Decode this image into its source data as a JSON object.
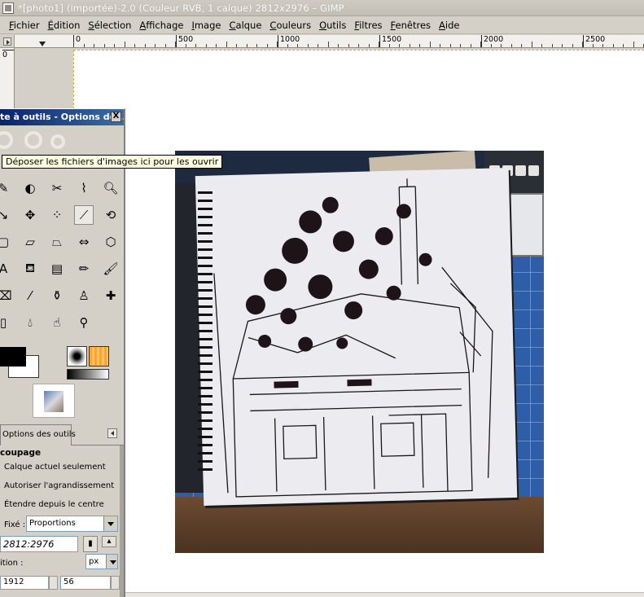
{
  "window": {
    "title": "*[photo1] (importée)-2.0 (Couleur RVB, 1 calque) 2812x2976 – GIMP"
  },
  "menu": [
    "Fichier",
    "Édition",
    "Sélection",
    "Affichage",
    "Image",
    "Calque",
    "Couleurs",
    "Outils",
    "Filtres",
    "Fenêtres",
    "Aide"
  ],
  "ruler": {
    "h_labels": [
      "0",
      "500",
      "1000",
      "1500",
      "2000",
      "2500"
    ],
    "v_labels": [
      "0"
    ]
  },
  "tooltip": "Déposer les fichiers d'images ici pour les ouvrir",
  "toolbox": {
    "title": "te à outils - Options de...",
    "close_label": "X",
    "tab_label": "Options des outils",
    "tool_options": {
      "section": "coupage",
      "opt_current_layer": "Calque actuel seulement",
      "opt_allow_growing": "Autoriser l'agrandissement",
      "opt_expand_center": "Étendre depuis le centre",
      "fixed_label": "Fixé :",
      "fixed_value": "Proportions",
      "ratio_value": "2812:2976",
      "position_label": "ition :",
      "unit_value": "px",
      "pos_x": "1912",
      "pos_y": "56"
    }
  }
}
